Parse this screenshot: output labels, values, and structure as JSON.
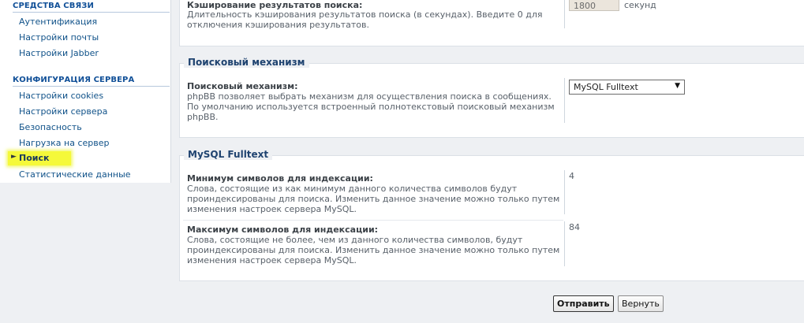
{
  "sidebar": {
    "section1_title": "СРЕДСТВА СВЯЗИ",
    "section1_items": [
      "Аутентификация",
      "Настройки почты",
      "Настройки Jabber"
    ],
    "section2_title": "КОНФИГУРАЦИЯ СЕРВЕРА",
    "section2_items": [
      "Настройки cookies",
      "Настройки сервера",
      "Безопасность",
      "Нагрузка на сервер",
      "Поиск",
      "Статистические данные"
    ]
  },
  "cache": {
    "title": "Кэширование результатов поиска:",
    "desc1": "Длительность кэширования результатов поиска (в секундах). Введите 0 для",
    "desc2": "отключения кэширования результатов.",
    "value": "1800",
    "unit": "секунд"
  },
  "engine": {
    "legend": "Поисковый механизм",
    "title": "Поисковый механизм:",
    "desc1": "phpBB позволяет выбрать механизм для осуществления поиска в сообщениях.",
    "desc2": "По умолчанию используется встроенный полнотекстовый поисковый механизм",
    "desc3": "phpBB.",
    "selected": "MySQL Fulltext"
  },
  "fulltext": {
    "legend": "MySQL Fulltext",
    "min_title": "Минимум символов для индексации:",
    "min_desc1": "Слова, состоящие из как минимум данного количества символов будут",
    "min_desc2": "проиндексированы для поиска. Изменить данное значение можно только путем",
    "min_desc3": "изменения настроек сервера MySQL.",
    "min_value": "4",
    "max_title": "Максимум символов для индексации:",
    "max_desc1": "Слова, состоящие не более, чем из данного количества символов, будут",
    "max_desc2": "проиндексированы для поиска. Изменить данное значение можно только путем",
    "max_desc3": "изменения настроек сервера MySQL.",
    "max_value": "84"
  },
  "buttons": {
    "submit": "Отправить",
    "reset": "Вернуть"
  },
  "colors": {
    "highlight": "#f5f93a",
    "link": "#105289",
    "heading": "#115098"
  },
  "icons": {
    "active_marker": "arrow-right-icon",
    "select_caret": "caret-down-icon"
  }
}
